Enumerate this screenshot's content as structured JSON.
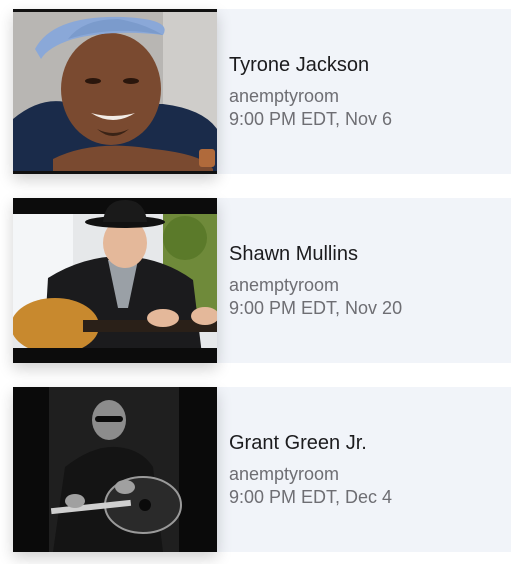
{
  "events": [
    {
      "name": "Tyrone Jackson",
      "host": "anemptyroom",
      "time": "9:00 PM EDT, Nov 6"
    },
    {
      "name": "Shawn Mullins",
      "host": "anemptyroom",
      "time": "9:00 PM EDT, Nov 20"
    },
    {
      "name": "Grant Green Jr.",
      "host": "anemptyroom",
      "time": "9:00 PM EDT, Dec 4"
    }
  ]
}
